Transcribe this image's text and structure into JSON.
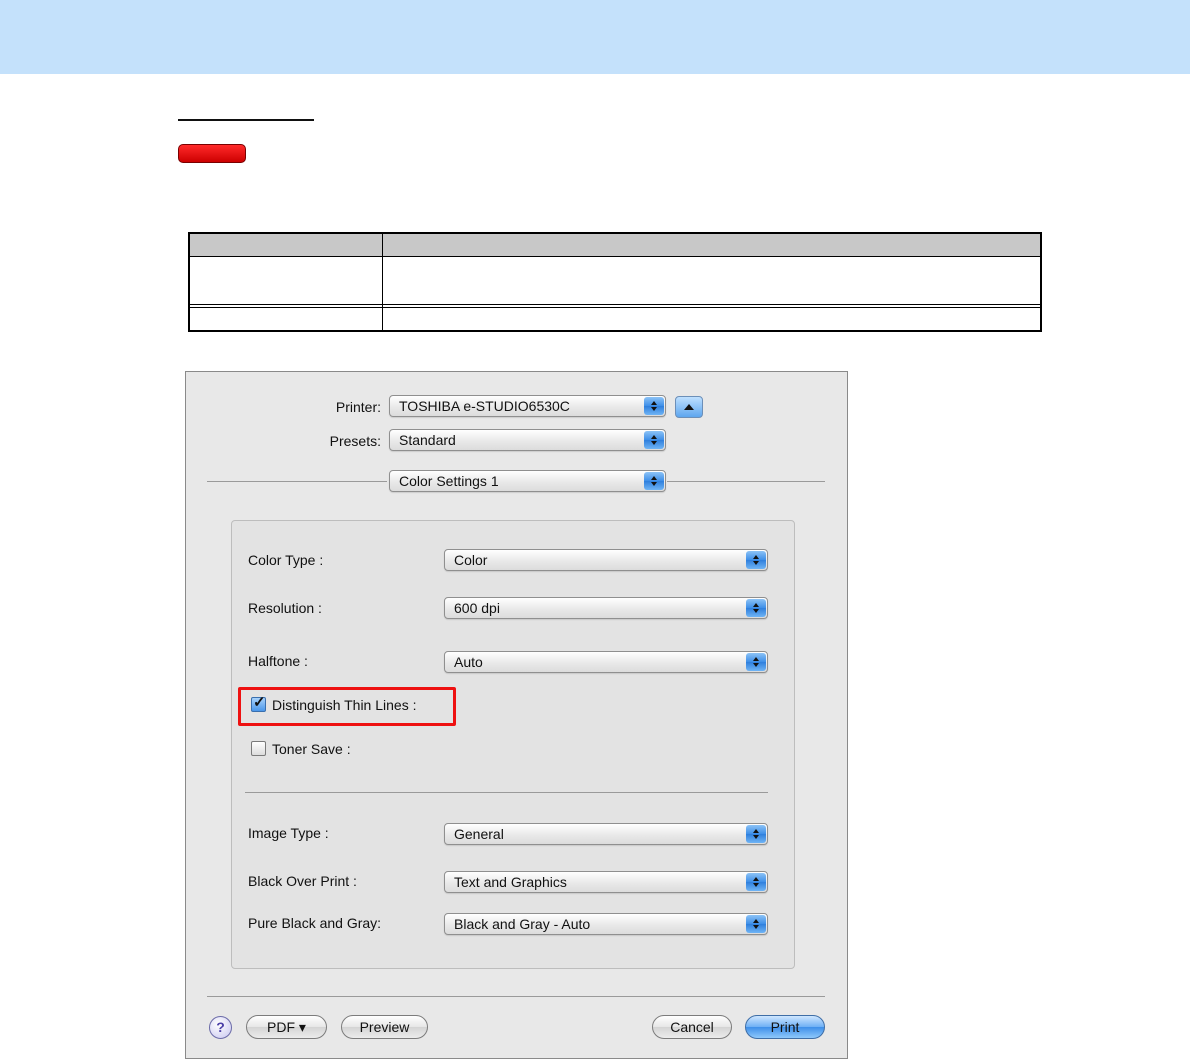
{
  "dialog": {
    "printer": {
      "label": "Printer:",
      "value": "TOSHIBA e-STUDIO6530C"
    },
    "presets": {
      "label": "Presets:",
      "value": "Standard"
    },
    "panel": {
      "value": "Color Settings 1"
    },
    "color_type": {
      "label": "Color Type :",
      "value": "Color"
    },
    "resolution": {
      "label": "Resolution :",
      "value": "600 dpi"
    },
    "halftone": {
      "label": "Halftone :",
      "value": "Auto"
    },
    "distinguish_thin_lines": {
      "label": "Distinguish Thin Lines :",
      "checked": true
    },
    "toner_save": {
      "label": "Toner Save :",
      "checked": false
    },
    "image_type": {
      "label": "Image Type :",
      "value": "General"
    },
    "black_over_print": {
      "label": "Black Over Print :",
      "value": "Text and Graphics"
    },
    "pure_black_and_gray": {
      "label": "Pure Black and Gray:",
      "value": "Black and Gray - Auto"
    },
    "buttons": {
      "help": "?",
      "pdf": "PDF ▾",
      "preview": "Preview",
      "cancel": "Cancel",
      "print": "Print"
    }
  },
  "colors": {
    "header_band": "#c4e1fb",
    "highlight": "#ee1111",
    "tag": "#ff0000"
  },
  "icons": {
    "popup": "up-down-arrows-icon",
    "disclosure": "triangle-up-icon",
    "help": "question-mark-icon"
  }
}
